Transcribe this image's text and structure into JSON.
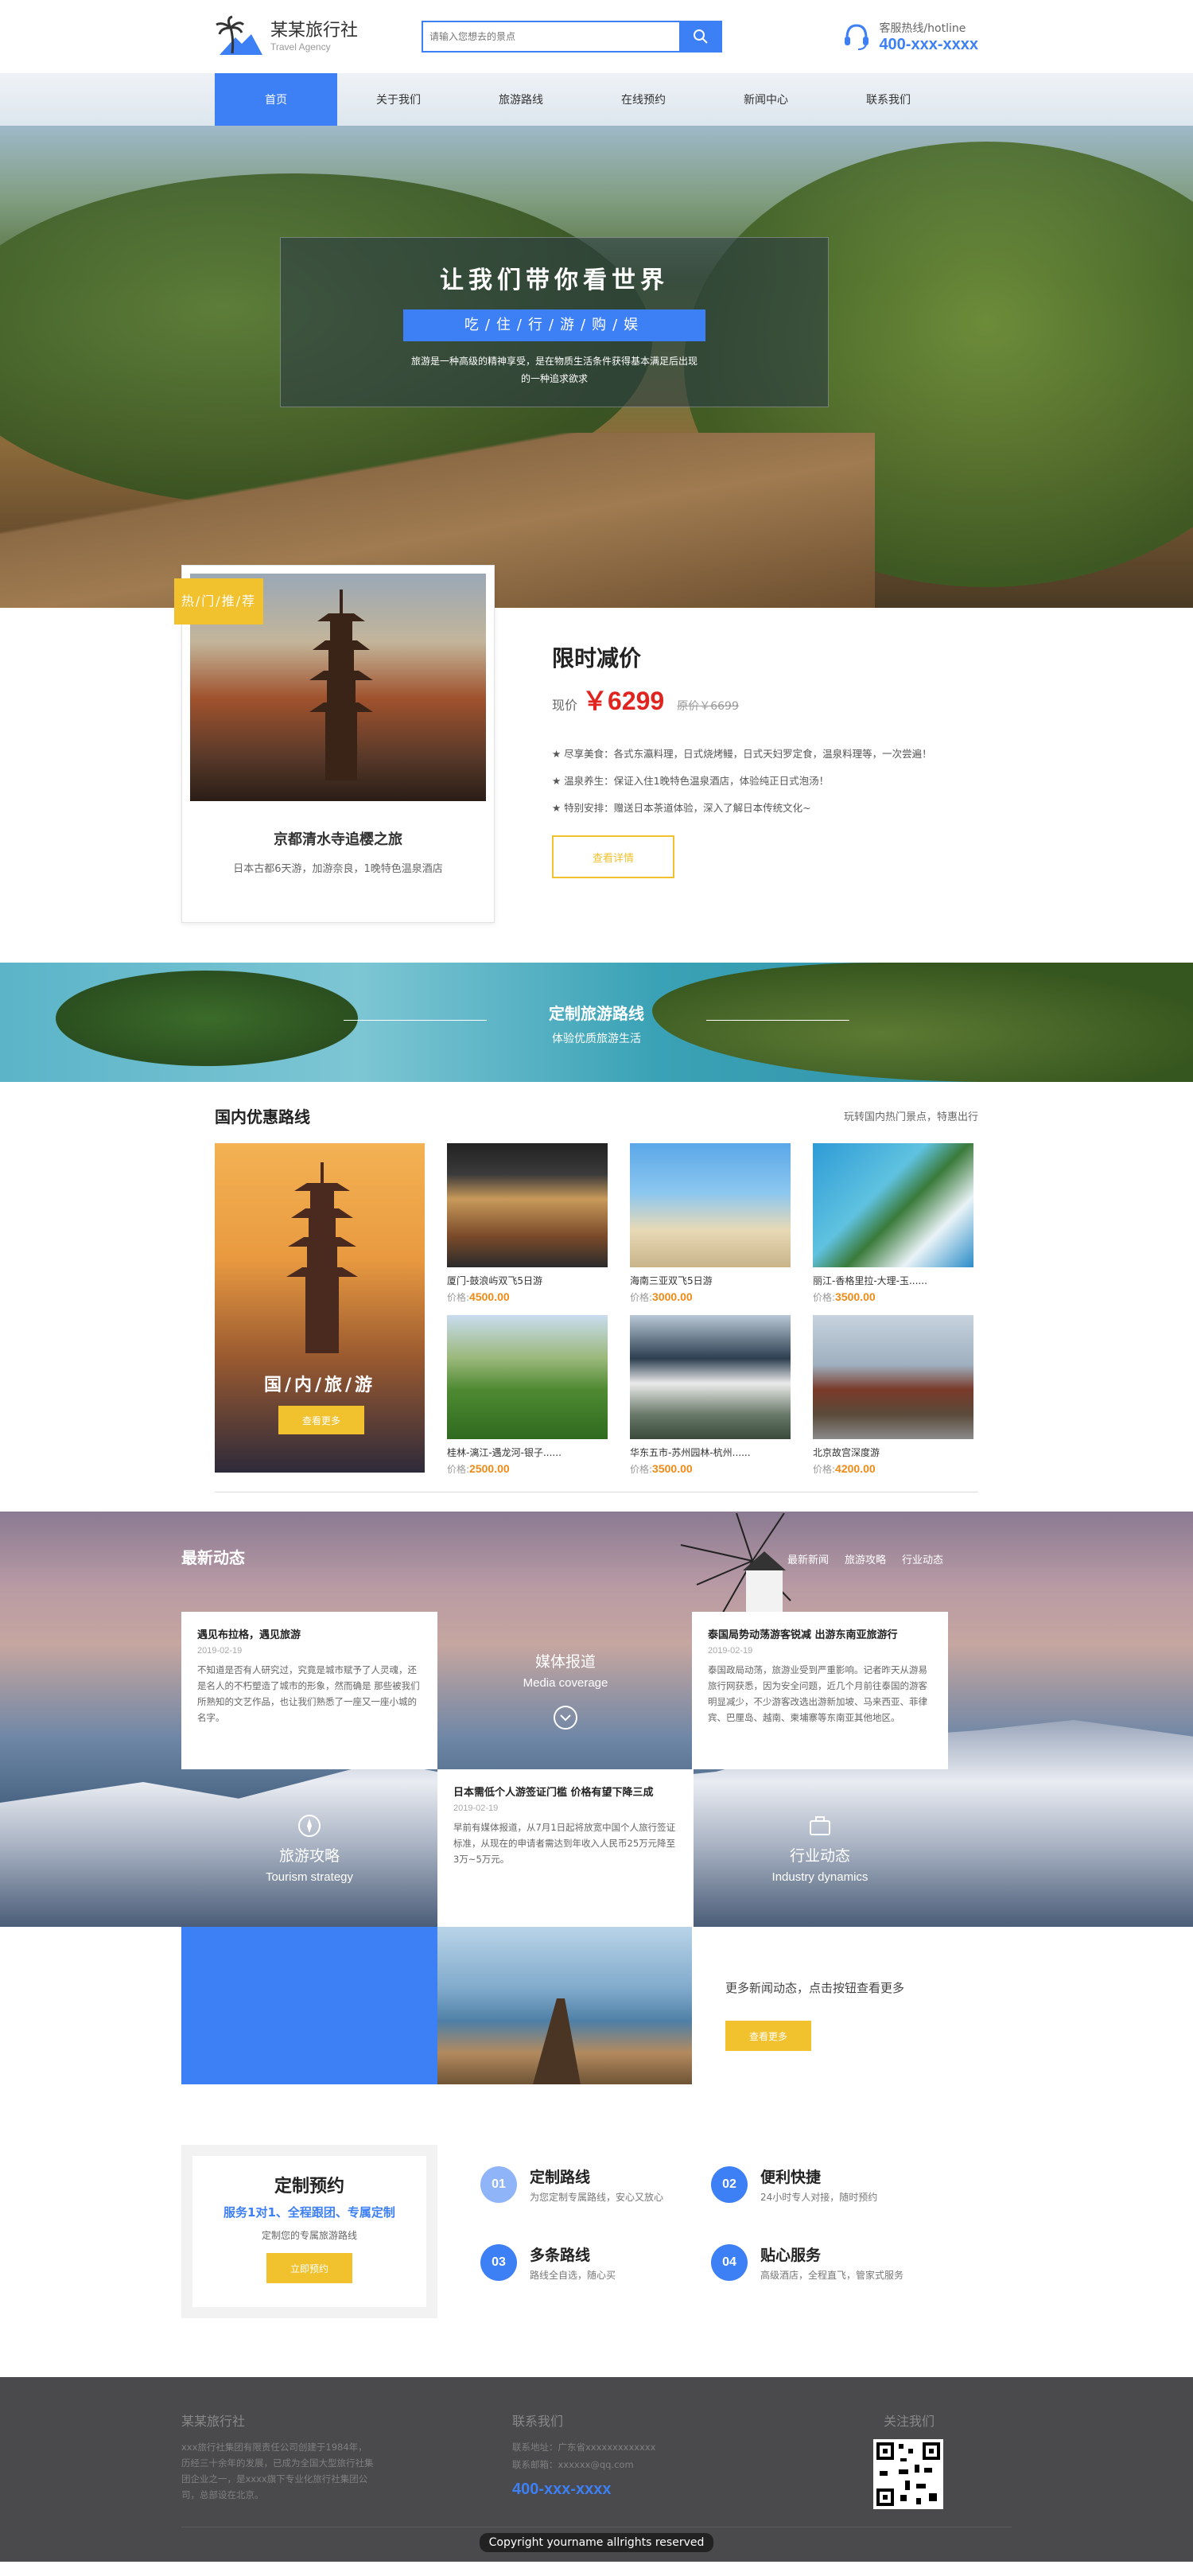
{
  "header": {
    "logo_title": "某某旅行社",
    "logo_sub": "Travel Agency",
    "search_placeholder": "请输入您想去的景点",
    "hotline_label": "客服热线/hotline",
    "hotline_number": "400-xxx-xxxx"
  },
  "nav": {
    "items": [
      "首页",
      "关于我们",
      "旅游路线",
      "在线预约",
      "新闻中心",
      "联系我们"
    ],
    "active_index": 0
  },
  "hero": {
    "title": "让我们带你看世界",
    "tagline": "吃/住/行/游/购/娱",
    "description": "旅游是一种高级的精神享受，是在物质生活条件获得基本满足后出现的一种追求欲求"
  },
  "featured": {
    "badge": "热/门/推/荐",
    "name": "京都清水寺追樱之旅",
    "desc": "日本古都6天游，加游奈良，1晚特色温泉酒店",
    "sale_label": "限时减价",
    "price_label": "现价",
    "price": "￥6299",
    "original_price": "原价￥6699",
    "points": [
      "★ 尽享美食：各式东瀛料理，日式烧烤鳗，日式天妇罗定食，温泉料理等，一次尝遍！",
      "★ 温泉养生：保证入住1晚特色温泉酒店，体验纯正日式泡汤！",
      "★ 特别安排：赠送日本茶道体验，深入了解日本传统文化~"
    ],
    "button": "查看详情"
  },
  "custom_banner": {
    "title": "定制旅游路线",
    "subtitle": "体验优质旅游生活"
  },
  "domestic": {
    "title": "国内优惠路线",
    "more": "玩转国内热门景点，特惠出行",
    "main_label": "国/内/旅/游",
    "main_button": "查看更多",
    "price_prefix": "价格:",
    "items": [
      {
        "name": "厦门-鼓浪屿双飞5日游",
        "price": "4500.00"
      },
      {
        "name": "海南三亚双飞5日游",
        "price": "3000.00"
      },
      {
        "name": "丽江-香格里拉-大理-玉......",
        "price": "3500.00"
      },
      {
        "name": "桂林-漓江-遇龙河-银子......",
        "price": "2500.00"
      },
      {
        "name": "华东五市-苏州园林-杭州......",
        "price": "3500.00"
      },
      {
        "name": "北京故宫深度游",
        "price": "4200.00"
      }
    ]
  },
  "news": {
    "title": "最新动态",
    "tabs": [
      "最新新闻",
      "旅游攻略",
      "行业动态"
    ],
    "articles": [
      {
        "title": "遇见布拉格，遇见旅游",
        "date": "2019-02-19",
        "summary": "不知道是否有人研究过，究竟是城市赋予了人灵魂，还是名人的不朽塑造了城市的形象，然而确是 那些被我们所熟知的文艺作品，也让我们熟悉了一座又一座小城的名字。"
      },
      {
        "title": "泰国局势动荡游客锐减 出游东南亚旅游行",
        "date": "2019-02-19",
        "summary": "泰国政局动荡，旅游业受到严重影响。记者昨天从游易旅行网获悉，因为安全问题，近几个月前往泰国的游客明显减少，不少游客改选出游新加坡、马来西亚、菲律宾、巴厘岛、越南、柬埔寨等东南亚其他地区。"
      },
      {
        "title": "日本需低个人游签证门槛 价格有望下降三成",
        "date": "2019-02-19",
        "summary": "早前有媒体报道，从7月1日起将放宽中国个人旅行签证标准，从现在的申请者需达到年收入人民币25万元降至3万~5万元。"
      }
    ],
    "categories": [
      {
        "cn": "媒体报道",
        "en": "Media coverage"
      },
      {
        "cn": "旅游攻略",
        "en": "Tourism strategy"
      },
      {
        "cn": "行业动态",
        "en": "Industry dynamics"
      }
    ],
    "more_text": "更多新闻动态，点击按钮查看更多",
    "more_button": "查看更多"
  },
  "booking": {
    "title": "定制预约",
    "subtitle": "服务1对1、全程跟团、专属定制",
    "desc": "定制您的专属旅游路线",
    "button": "立即预约",
    "features": [
      {
        "num": "01",
        "title": "定制路线",
        "desc": "为您定制专属路线，安心又放心"
      },
      {
        "num": "02",
        "title": "便利快捷",
        "desc": "24小时专人对接，随时预约"
      },
      {
        "num": "03",
        "title": "多条路线",
        "desc": "路线全自选，随心买"
      },
      {
        "num": "04",
        "title": "贴心服务",
        "desc": "高级酒店，全程直飞，管家式服务"
      }
    ]
  },
  "footer": {
    "about_title": "某某旅行社",
    "about_text": "xxx旅行社集团有限责任公司创建于1984年，历经三十余年的发展，已成为全国大型旅行社集团企业之一，是xxxx旗下专业化旅行社集团公司，总部设在北京。",
    "contact_title": "联系我们",
    "address": "联系地址：广东省xxxxxxxxxxxxx",
    "email": "联系邮箱：xxxxxx@qq.com",
    "phone": "400-xxx-xxxx",
    "follow_title": "关注我们",
    "copyright": "Copyright yourname allrights reserved"
  },
  "colors": {
    "primary": "#3d7ff5",
    "accent": "#f2c12e",
    "price": "#e0241f",
    "footer_bg": "#4a4a4c"
  }
}
